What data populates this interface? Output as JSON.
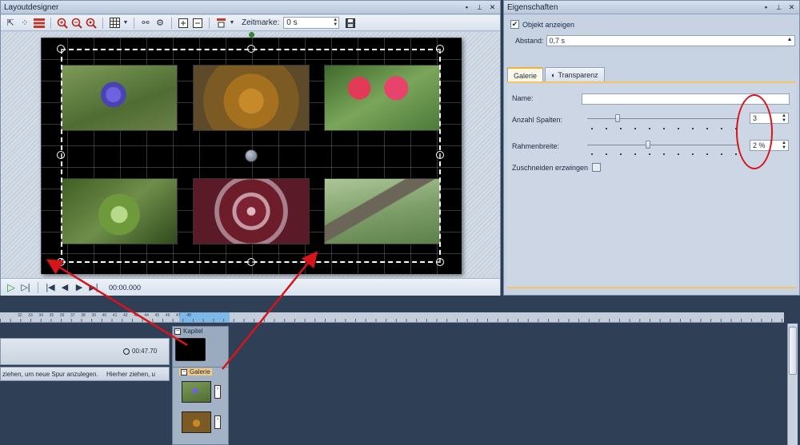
{
  "layoutdesigner": {
    "title": "Layoutdesigner",
    "zeitmarke_label": "Zeitmarke:",
    "zeitmarke_value": "0 s",
    "timecode": "00:00.000"
  },
  "eigenschaften": {
    "title": "Eigenschaften",
    "objekt_anzeigen": "Objekt anzeigen",
    "objekt_anzeigen_checked": true,
    "abstand_label": "Abstand:",
    "abstand_value": "0,7 s",
    "tabs": [
      {
        "label": "Galerie",
        "active": true
      },
      {
        "label": "Transparenz",
        "active": false
      }
    ],
    "name_label": "Name:",
    "name_value": "",
    "spalten_label": "Anzahl Spalten:",
    "spalten_value": "3",
    "spalten_level": 0.2,
    "rahmen_label": "Rahmenbreite:",
    "rahmen_value": "2 %",
    "rahmen_level": 0.4,
    "zuschneiden_label": "Zuschneiden erzwingen",
    "zuschneiden_checked": false
  },
  "timeline": {
    "ruler_labels": [
      "32",
      "33",
      "34",
      "35",
      "36",
      "37",
      "38",
      "39",
      "40",
      "41",
      "42",
      "43",
      "44",
      "45",
      "46",
      "47",
      "48"
    ],
    "duration": "00:47.70",
    "drop_hint_1": "ziehen, um neue Spur anzulegen.",
    "drop_hint_2": "Hierher ziehen, u",
    "kapitel_label": "Kapitel",
    "galerie_label": "Galerie"
  },
  "colors": {
    "accent_orange": "#f0b23b",
    "annotation_red": "#d7141a",
    "ruler_highlight": "#7db8e8"
  },
  "icons": [
    "pointer-icon",
    "transform-icon",
    "layers-icon",
    "zoom-in-icon",
    "zoom-out-icon",
    "zoom-fit-icon",
    "grid-icon",
    "settings-icon",
    "add-icon",
    "remove-icon",
    "align-icon",
    "save-icon",
    "play-icon",
    "step-icon",
    "skip-start-icon",
    "prev-icon",
    "next-icon",
    "skip-end-icon"
  ]
}
